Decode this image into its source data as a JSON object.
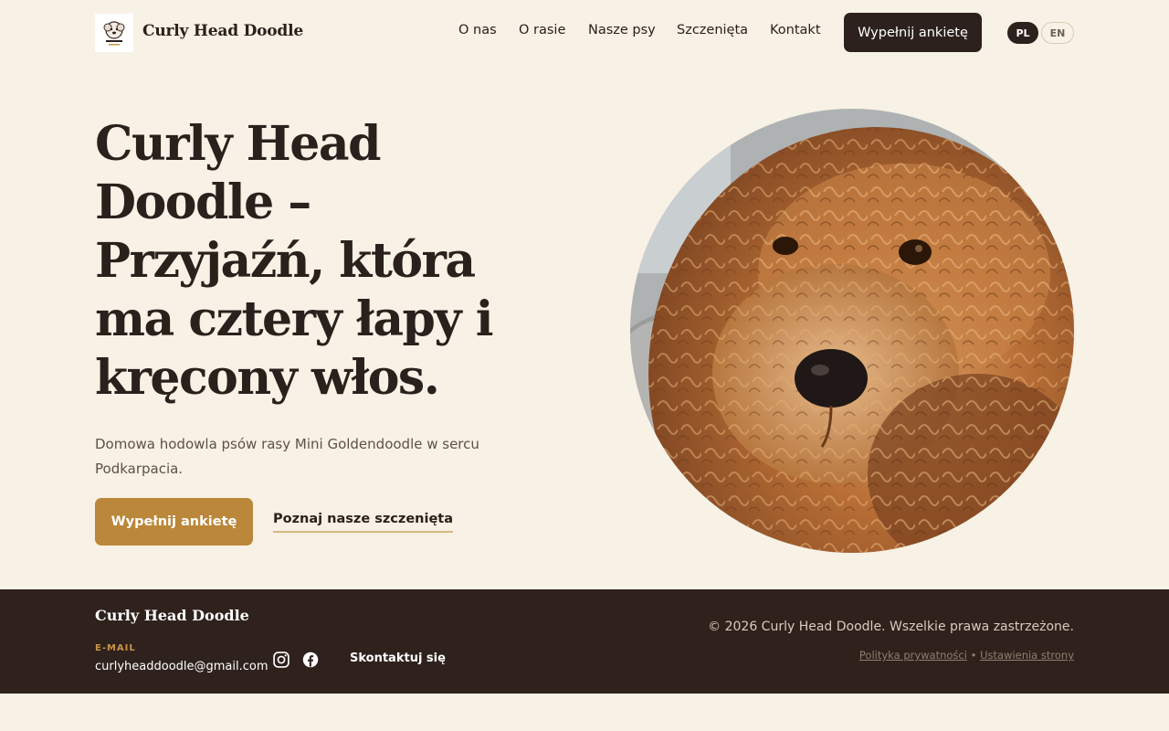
{
  "header": {
    "brand": "Curly Head Doodle",
    "logo_text": "CURLY HEAD DOODLE",
    "nav": [
      {
        "label": "O nas"
      },
      {
        "label": "O rasie"
      },
      {
        "label": "Nasze psy"
      },
      {
        "label": "Szczenięta"
      },
      {
        "label": "Kontakt"
      }
    ],
    "cta_label": "Wypełnij ankietę",
    "lang": {
      "pl": "PL",
      "en": "EN",
      "active": "PL"
    }
  },
  "hero": {
    "title": "Curly Head Doodle – Przyjaźń, która ma cztery łapy i kręcony włos.",
    "subtitle": "Domowa hodowla psów rasy Mini Goldendoodle w sercu Podkarpacia.",
    "cta_label": "Wypełnij ankietę",
    "link_label": "Poznaj nasze szczenięta",
    "image_icon": "puppy-photo"
  },
  "footer": {
    "brand": "Curly Head Doodle",
    "email_label": "E-MAIL",
    "email": "curlyheaddoodle@gmail.com",
    "contact_label": "Skontaktuj się",
    "copyright": "© 2026 Curly Head Doodle. Wszelkie prawa zastrzeżone.",
    "privacy_label": "Polityka prywatności",
    "separator": "•",
    "settings_label": "Ustawienia strony"
  },
  "colors": {
    "background": "#f8f1e5",
    "dark": "#2c211d",
    "accent": "#bb873a",
    "footer": "#2f221d"
  }
}
